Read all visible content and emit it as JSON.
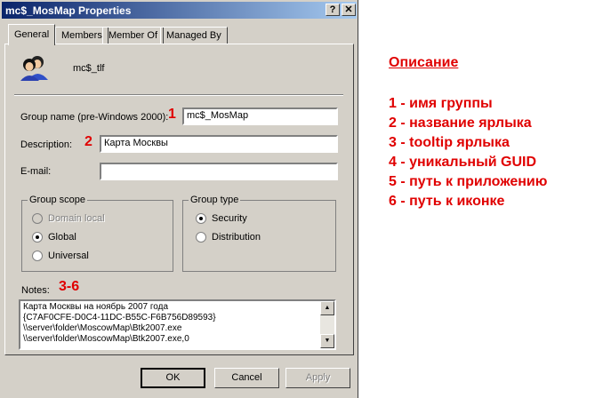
{
  "window": {
    "title": "mc$_MosMap Properties",
    "help_glyph": "?",
    "close_glyph": "✕"
  },
  "tabs": [
    "General",
    "Members",
    "Member Of",
    "Managed By"
  ],
  "general": {
    "display_name": "mc$_tlf",
    "group_name_label": "Group name (pre-Windows 2000):",
    "group_name_value": "mc$_MosMap",
    "description_label": "Description:",
    "description_value": "Карта Москвы",
    "email_label": "E-mail:",
    "email_value": "",
    "group_scope": {
      "title": "Group scope",
      "options": [
        {
          "label": "Domain local",
          "checked": false,
          "disabled": true
        },
        {
          "label": "Global",
          "checked": true,
          "disabled": false
        },
        {
          "label": "Universal",
          "checked": false,
          "disabled": false
        }
      ]
    },
    "group_type": {
      "title": "Group type",
      "options": [
        {
          "label": "Security",
          "checked": true
        },
        {
          "label": "Distribution",
          "checked": false
        }
      ]
    },
    "notes_label": "Notes:",
    "notes_lines": [
      "Карта Москвы на ноябрь 2007 года",
      "{C7AF0CFE-D0C4-11DC-B55C-F6B756D89593}",
      "\\\\server\\folder\\MoscowMap\\Btk2007.exe",
      "\\\\server\\folder\\MoscowMap\\Btk2007.exe,0"
    ]
  },
  "markers": {
    "group_name": "1",
    "description": "2",
    "notes": "3-6"
  },
  "buttons": {
    "ok": "OK",
    "cancel": "Cancel",
    "apply": "Apply"
  },
  "legend": {
    "title": "Описание",
    "items": [
      "1 - имя группы",
      "2 - название ярлыка",
      "3 - tooltip ярлыка",
      "4 - уникальный GUID",
      "5 - путь к приложению",
      "6 - путь к иконке"
    ]
  },
  "colors": {
    "titlebar": "#0a246a",
    "annotation_red": "#e00000",
    "dialog_face": "#d4d0c8"
  }
}
